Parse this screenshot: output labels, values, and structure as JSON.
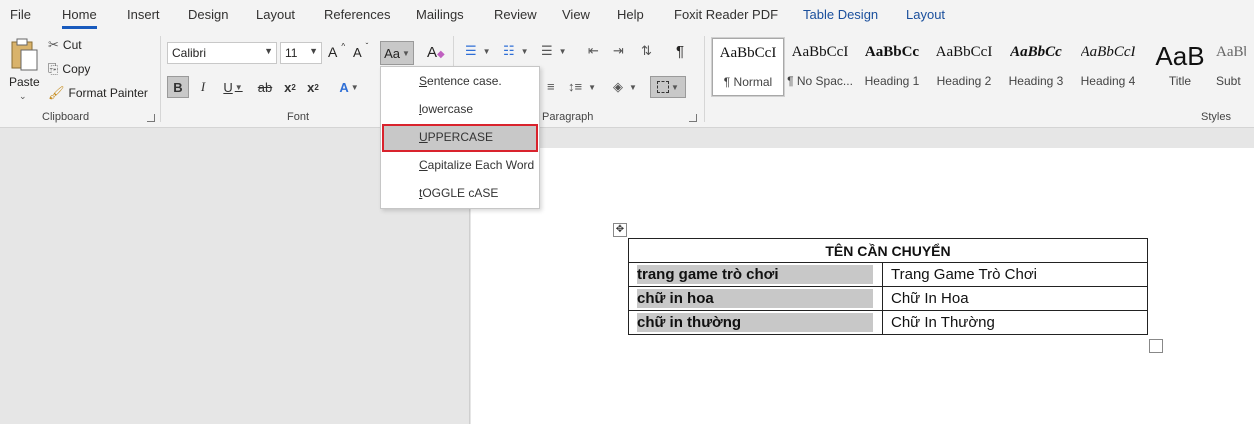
{
  "menu": {
    "tabs": [
      "File",
      "Home",
      "Insert",
      "Design",
      "Layout",
      "References",
      "Mailings",
      "Review",
      "View",
      "Help",
      "Foxit Reader PDF",
      "Table Design",
      "Layout"
    ]
  },
  "clipboard": {
    "paste": "Paste",
    "cut": "Cut",
    "copy": "Copy",
    "format_painter": "Format Painter",
    "label": "Clipboard"
  },
  "font": {
    "family": "Calibri",
    "size": "11",
    "grow": "A",
    "shrink": "A",
    "change_case": "Aa",
    "bold": "B",
    "italic": "I",
    "underline": "U",
    "strike": "ab",
    "subscript": "x",
    "superscript": "x",
    "label": "Font"
  },
  "paragraph": {
    "pilcrow": "¶",
    "label": "Paragraph"
  },
  "styles": {
    "label": "Styles",
    "items": [
      {
        "sample": "AaBbCcI",
        "name": "¶ Normal"
      },
      {
        "sample": "AaBbCcI",
        "name": "¶ No Spac..."
      },
      {
        "sample": "AaBbCc",
        "name": "Heading 1"
      },
      {
        "sample": "AaBbCcI",
        "name": "Heading 2"
      },
      {
        "sample": "AaBbCc",
        "name": "Heading 3"
      },
      {
        "sample": "AaBbCcI",
        "name": "Heading 4"
      },
      {
        "sample": "AaB",
        "name": "Title"
      },
      {
        "sample": "AaBbC",
        "name": "Subt"
      }
    ]
  },
  "change_case_menu": {
    "items": [
      {
        "accel": "S",
        "rest": "entence case."
      },
      {
        "accel": "l",
        "rest": "owercase"
      },
      {
        "accel": "U",
        "rest": "PPERCASE"
      },
      {
        "accel": "C",
        "rest": "apitalize Each Word"
      },
      {
        "accel": "t",
        "rest": "OGGLE cASE"
      }
    ]
  },
  "table": {
    "header": "TÊN CẦN CHUYỂN",
    "rows": [
      {
        "left": "trang game trò chơi",
        "right": "Trang Game Trò Chơi"
      },
      {
        "left": "chữ in hoa",
        "right": "Chữ In Hoa"
      },
      {
        "left": "chữ in thường",
        "right": "Chữ In Thường"
      }
    ]
  },
  "colors": {
    "highlight_border": "#d9232d",
    "accent": "#185abd"
  }
}
